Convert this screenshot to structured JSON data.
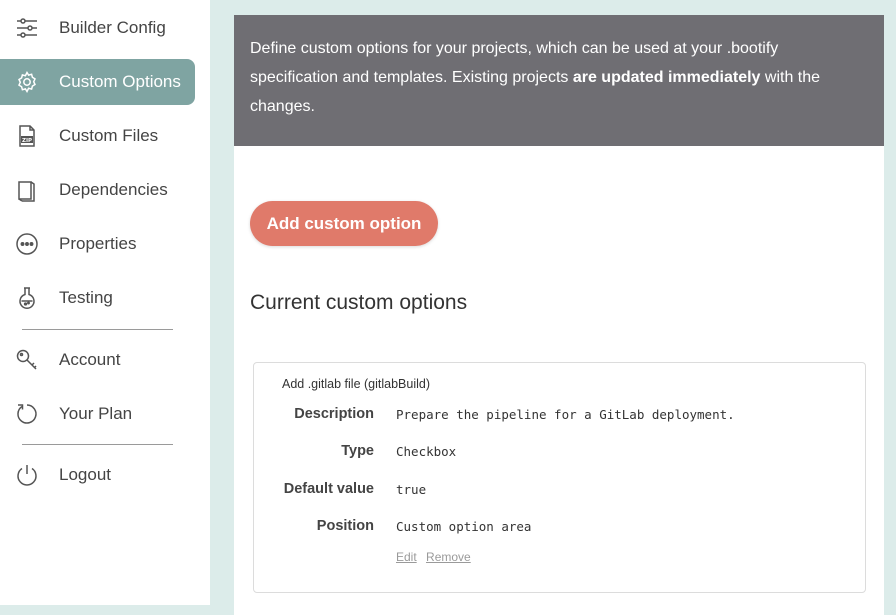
{
  "sidebar": {
    "items": [
      {
        "label": "Builder Config",
        "icon": "sliders-icon"
      },
      {
        "label": "Custom Options",
        "icon": "gear-icon",
        "active": true
      },
      {
        "label": "Custom Files",
        "icon": "zip-file-icon"
      },
      {
        "label": "Dependencies",
        "icon": "book-icon"
      },
      {
        "label": "Properties",
        "icon": "ellipsis-circle-icon"
      },
      {
        "label": "Testing",
        "icon": "flask-icon"
      },
      {
        "label": "Account",
        "icon": "key-icon"
      },
      {
        "label": "Your Plan",
        "icon": "refresh-icon"
      },
      {
        "label": "Logout",
        "icon": "power-icon"
      }
    ]
  },
  "banner": {
    "text_before": "Define custom options for your projects, which can be used at your .bootify specification and templates. Existing projects ",
    "text_bold": "are updated immediately",
    "text_after": " with the changes."
  },
  "main": {
    "add_button_label": "Add custom option",
    "section_title": "Current custom options",
    "options": [
      {
        "title": "Add .gitlab file (gitlabBuild)",
        "rows": [
          {
            "label": "Description",
            "value": "Prepare the pipeline for a GitLab deployment."
          },
          {
            "label": "Type",
            "value": "Checkbox"
          },
          {
            "label": "Default value",
            "value": "true"
          },
          {
            "label": "Position",
            "value": "Custom option area"
          }
        ],
        "edit_label": "Edit",
        "remove_label": "Remove"
      }
    ]
  },
  "colors": {
    "accent": "#e07a6a",
    "active_nav": "#7fa4a2",
    "banner_bg": "#6f6e73",
    "page_bg": "#dcecea"
  }
}
